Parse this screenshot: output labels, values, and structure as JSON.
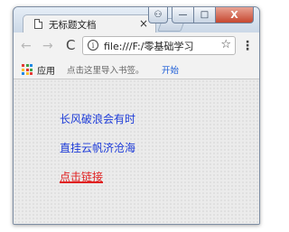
{
  "browser": {
    "tab_title": "无标题文档",
    "tab_close": "×",
    "url": "file:///F:/零基础学习",
    "info_icon": "i",
    "star_icon": "☆",
    "menu_icon": "⋮",
    "reload_icon": "C",
    "back_icon": "←",
    "forward_icon": "→"
  },
  "window_controls": {
    "close": "X",
    "maximize": "□",
    "minimize": "—",
    "user": "⚇"
  },
  "bookmarks": {
    "apps_label": "应用",
    "import_hint": "点击这里导入书签。",
    "start_link": "开始",
    "apps_colors": [
      "#e53935",
      "#43a047",
      "#1e88e5",
      "#fbc02d",
      "#e53935",
      "#43a047",
      "#1e88e5",
      "#fbc02d",
      "#e53935"
    ]
  },
  "page": {
    "line1": "长风破浪会有时",
    "line2": "直挂云帆济沧海",
    "link": "点击链接"
  },
  "colors": {
    "text_blue": "#1d3bd8",
    "link_red": "#e02020"
  }
}
